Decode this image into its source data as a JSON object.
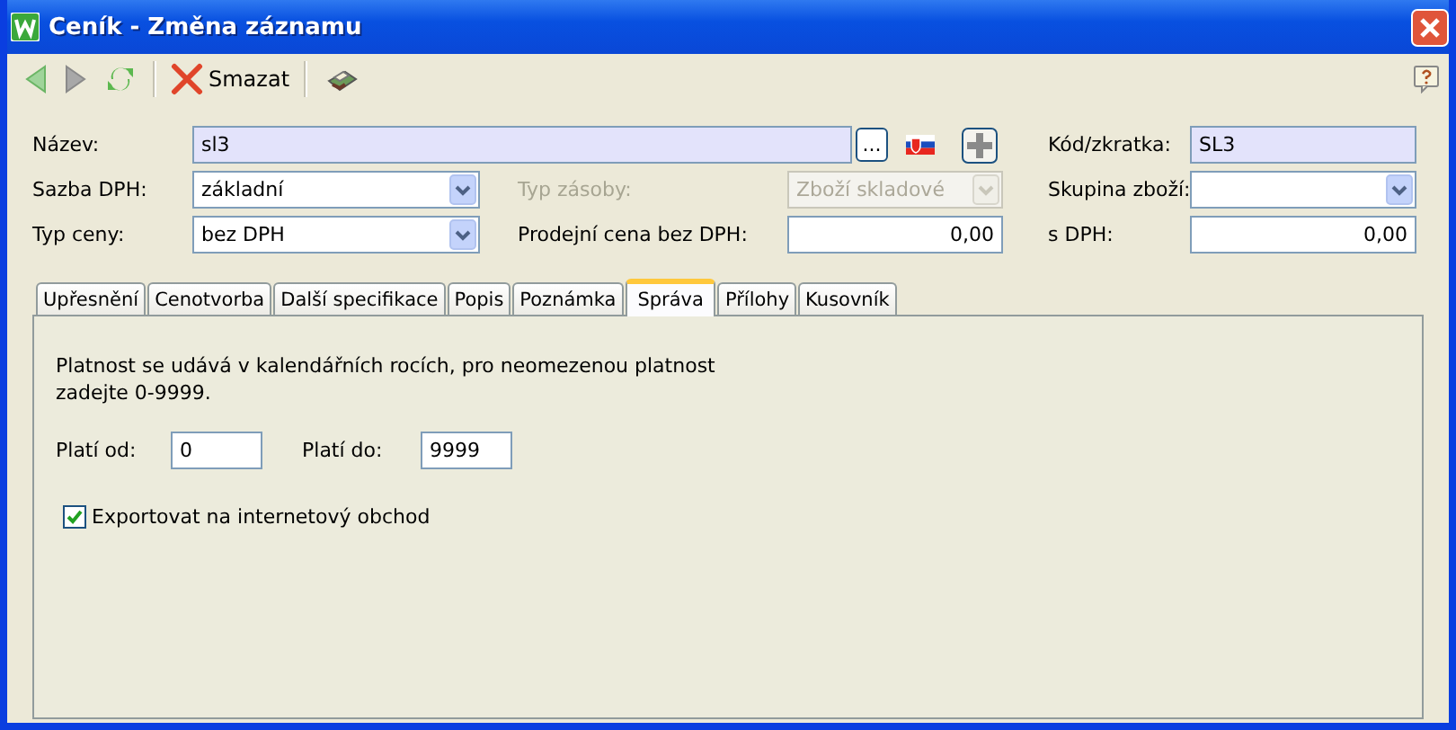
{
  "window": {
    "title": "Ceník - Změna záznamu"
  },
  "toolbar": [
    {
      "kind": "back",
      "disabled": false
    },
    {
      "kind": "forward",
      "disabled": true
    },
    {
      "kind": "refresh",
      "disabled": false
    },
    {
      "kind": "delete",
      "label": "Smazat",
      "disabled": false
    },
    {
      "kind": "print",
      "disabled": false
    }
  ],
  "form": {
    "name": {
      "label": "Název:",
      "value": "sl3",
      "browse_label": "..."
    },
    "code": {
      "label": "Kód/zkratka:",
      "value": "SL3"
    },
    "vat_rate": {
      "label": "Sazba DPH:",
      "value": "základní"
    },
    "stock_type": {
      "label": "Typ zásoby:",
      "value": "Zboží skladové",
      "disabled": true
    },
    "goods_group": {
      "label": "Skupina zboží:"
    },
    "price_type": {
      "label": "Typ ceny:",
      "value": "bez DPH"
    },
    "price_excl": {
      "label": "Prodejní cena bez DPH:",
      "value": "0,00"
    },
    "price_incl": {
      "label": "s DPH:",
      "value": "0,00"
    }
  },
  "tabs": [
    {
      "label": "Upřesnění",
      "selected": false
    },
    {
      "label": "Cenotvorba",
      "selected": false
    },
    {
      "label": "Další specifikace",
      "selected": false
    },
    {
      "label": "Popis",
      "selected": false
    },
    {
      "label": "Poznámka",
      "selected": false
    },
    {
      "label": "Správa",
      "selected": true
    },
    {
      "label": "Přílohy",
      "selected": false
    },
    {
      "label": "Kusovník",
      "selected": false
    }
  ],
  "panel": {
    "note": "Platnost se udává v kalendářních rocích, pro neomezenou platnost zadejte 0-9999.",
    "valid_from": {
      "label": "Platí od:",
      "value": "0"
    },
    "valid_to": {
      "label": "Platí do:",
      "value": "9999"
    },
    "export": {
      "label": "Exportovat na internetový obchod",
      "checked": true
    }
  }
}
